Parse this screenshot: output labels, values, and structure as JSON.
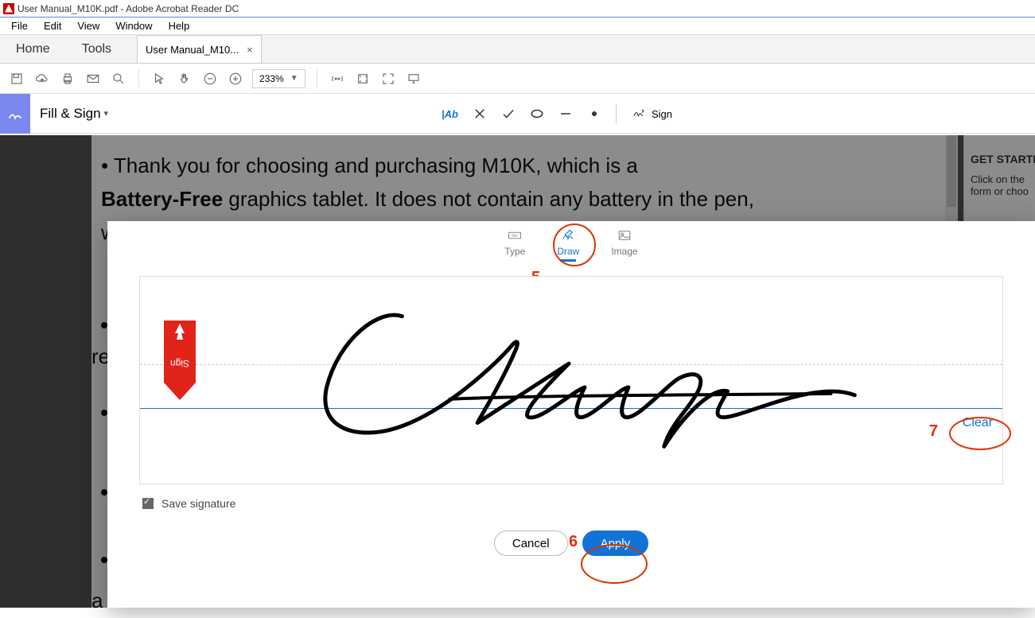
{
  "window": {
    "title": "User Manual_M10K.pdf - Adobe Acrobat Reader DC"
  },
  "menu": {
    "file": "File",
    "edit": "Edit",
    "view": "View",
    "window": "Window",
    "help": "Help"
  },
  "tabs": {
    "home": "Home",
    "tools": "Tools",
    "doc": "User Manual_M10..."
  },
  "toolbar": {
    "zoom": "233%"
  },
  "fillsign": {
    "title": "Fill & Sign",
    "ab": "|Ab",
    "sign": "Sign"
  },
  "rightpanel": {
    "title": "GET STARTED",
    "line1": "Click on the",
    "line2": "form or choo"
  },
  "pdf": {
    "line1_pre": "• Thank you for choosing and purchasing M10K, which is a",
    "line2_bold": "Battery-Free",
    "line2_rest": " graphics tablet. It does not contain any battery in the pen,",
    "frag_w": "w",
    "frag_re": "re",
    "frag_a": "a"
  },
  "sig": {
    "mode_type": "Type",
    "mode_draw": "Draw",
    "mode_image": "Image",
    "clear": "Clear",
    "save": "Save signature",
    "cancel": "Cancel",
    "apply": "Apply",
    "ribbon_text": "Sign"
  },
  "annot": {
    "n5": "5",
    "n6": "6",
    "n7": "7"
  }
}
